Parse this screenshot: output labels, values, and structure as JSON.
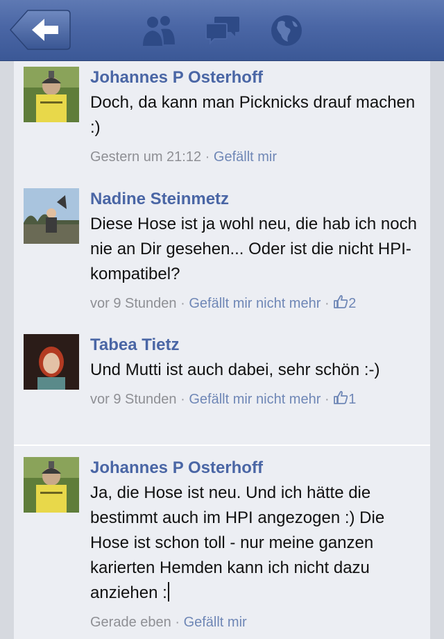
{
  "navbar": {
    "back": "back-arrow-icon",
    "icons": [
      "friends-icon",
      "messages-icon",
      "globe-icon"
    ]
  },
  "comments": [
    {
      "author": "Johannes P Osterhoff",
      "text": "Doch, da kann man Picknicks drauf machen :)",
      "time": "Gestern um 21:12",
      "like_link": "Gefällt mir"
    },
    {
      "author": "Nadine Steinmetz",
      "text": "Diese Hose ist ja wohl neu, die hab ich noch nie an Dir gesehen... Oder ist die nicht HPI-kompatibel?",
      "time": "vor 9 Stunden",
      "like_link": "Gefällt mir nicht mehr",
      "likes": "2"
    },
    {
      "author": "Tabea Tietz",
      "text": "Und Mutti ist auch dabei, sehr schön :-)",
      "time": "vor 9 Stunden",
      "like_link": "Gefällt mir nicht mehr",
      "likes": "1"
    },
    {
      "author": "Johannes P Osterhoff",
      "text": "Ja, die Hose ist neu. Und ich hätte die bestimmt auch im HPI angezogen :) Die Hose ist schon toll - nur meine ganzen karierten Hemden kann ich nicht dazu anziehen :",
      "time": "Gerade eben",
      "like_link": "Gefällt mir"
    }
  ],
  "separator": "·",
  "colors": {
    "navbar": "#4a66a5",
    "author": "#4a66a5",
    "link": "#6f87b6",
    "panel": "#eceef3"
  }
}
